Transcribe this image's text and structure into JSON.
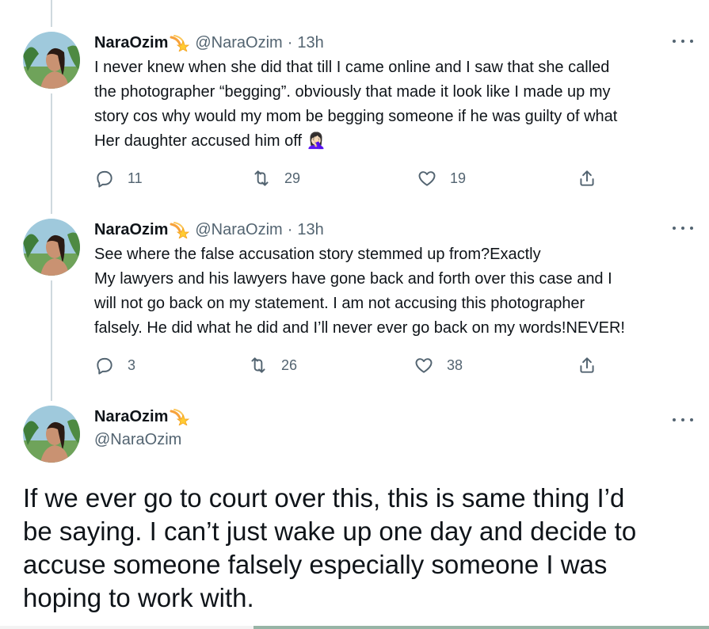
{
  "colors": {
    "text": "#0f1419",
    "secondary": "#536471",
    "thread_line": "#cfd9de"
  },
  "tweets": [
    {
      "name": "NaraOzim",
      "badge_icon": "shooting-star-emoji",
      "handle": "@NaraOzim",
      "separator": "·",
      "time": "13h",
      "lines": [
        "I never knew when she did that till I came online and I saw that she called",
        "the photographer “begging”. obviously that made it look like I made up my",
        "story cos why would my mom be begging someone if he was guilty of what",
        "Her daughter accused him off"
      ],
      "emoji": "🤦🏻‍♀️",
      "replies": "11",
      "retweets": "29",
      "likes": "19"
    },
    {
      "name": "NaraOzim",
      "badge_icon": "shooting-star-emoji",
      "handle": "@NaraOzim",
      "separator": "·",
      "time": "13h",
      "lines": [
        "See where the false accusation story stemmed up from?Exactly",
        "My lawyers and his lawyers have gone back and forth over this case and I",
        "will not go back on my statement. I am not accusing this photographer",
        "falsely. He did what he did and I’ll never ever go back on my words!NEVER!"
      ],
      "replies": "3",
      "retweets": "26",
      "likes": "38"
    }
  ],
  "main_tweet": {
    "name": "NaraOzim",
    "badge_icon": "shooting-star-emoji",
    "handle": "@NaraOzim",
    "lines": [
      "If we ever go to court over this, this  is same thing I’d",
      "be saying. I can’t just wake up one day and decide to",
      "accuse someone falsely especially someone I was",
      "hoping to work with."
    ]
  }
}
